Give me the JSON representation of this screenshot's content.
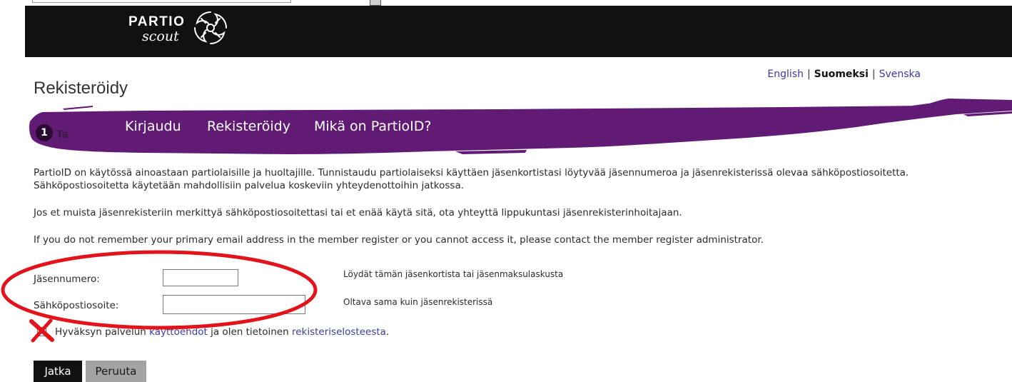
{
  "top_strip": {
    "input_value": ""
  },
  "header": {
    "logo_text_top": "PARTIO",
    "logo_text_bottom": "scout",
    "logo_icon": "scout-emblem-icon"
  },
  "languages": {
    "separator": "|",
    "items": [
      {
        "label": "English",
        "active": false
      },
      {
        "label": "Suomeksi",
        "active": true
      },
      {
        "label": "Svenska",
        "active": false
      }
    ]
  },
  "page_title": "Rekisteröidy",
  "steps": {
    "number": "1",
    "label_partial": "Ta"
  },
  "nav": {
    "items": [
      {
        "label": "Kirjaudu"
      },
      {
        "label": "Rekisteröidy"
      },
      {
        "label": "Mikä on PartioID?"
      }
    ]
  },
  "intro": {
    "line1": "PartioID on käytössä ainoastaan partiolaisille ja huoltajille. Tunnistaudu partiolaiseksi käyttäen jäsenkortistasi löytyvää jäsennumeroa ja jäsenrekisterissä olevaa sähköpostiosoitetta.",
    "line2": "Sähköpostiosoitetta käytetään mahdollisiin palvelua koskeviin yhteydenottoihin jatkossa.",
    "note_fi": "Jos et muista jäsenrekisteriin merkittyä sähköpostiosoitettasi tai et enää käytä sitä, ota yhteyttä lippukuntasi jäsenrekisterinhoitajaan.",
    "note_en": "If you do not remember your primary email address in the member register or you cannot access it, please contact the member register administrator."
  },
  "form": {
    "member_number": {
      "label": "Jäsennumero:",
      "value": "",
      "hint": "Löydät tämän jäsenkortista tai jäsenmaksulaskusta"
    },
    "email": {
      "label": "Sähköpostiosoite:",
      "value": "",
      "hint": "Oltava sama kuin jäsenrekisterissä"
    },
    "terms": {
      "checked": false,
      "text_before": "Hyväksyn palvelun ",
      "link_terms": "käyttöehdot",
      "text_middle": " ja olen tietoinen ",
      "link_privacy": "rekisteriselosteesta",
      "text_after": "."
    }
  },
  "buttons": {
    "continue": "Jatka",
    "cancel": "Peruuta"
  },
  "colors": {
    "purple": "#621b74",
    "link": "#3b3ba6",
    "header_bg": "#111111",
    "annotation_red": "#e3131b"
  }
}
